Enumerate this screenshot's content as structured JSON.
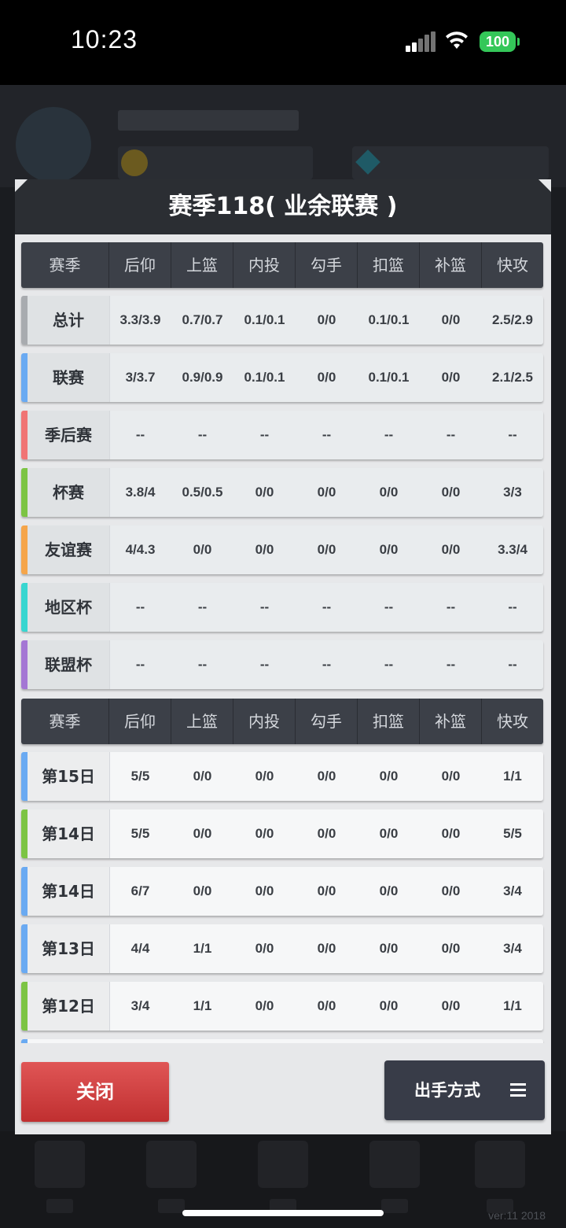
{
  "status_bar": {
    "time": "10:23",
    "battery": "100"
  },
  "version": "ver:11  2018",
  "dialog": {
    "title": "赛季118( 业余联赛 )",
    "close_label": "关闭",
    "shot_type_label": "出手方式"
  },
  "columns": [
    "赛季",
    "后仰",
    "上篮",
    "内投",
    "勾手",
    "扣篮",
    "补篮",
    "快攻"
  ],
  "season_rows": [
    {
      "label": "总计",
      "color": "#a8abaf",
      "values": [
        "3.3/3.9",
        "0.7/0.7",
        "0.1/0.1",
        "0/0",
        "0.1/0.1",
        "0/0",
        "2.5/2.9"
      ]
    },
    {
      "label": "联赛",
      "color": "#6aaaf2",
      "values": [
        "3/3.7",
        "0.9/0.9",
        "0.1/0.1",
        "0/0",
        "0.1/0.1",
        "0/0",
        "2.1/2.5"
      ]
    },
    {
      "label": "季后赛",
      "color": "#f07474",
      "values": [
        "--",
        "--",
        "--",
        "--",
        "--",
        "--",
        "--"
      ]
    },
    {
      "label": "杯赛",
      "color": "#7cc444",
      "values": [
        "3.8/4",
        "0.5/0.5",
        "0/0",
        "0/0",
        "0/0",
        "0/0",
        "3/3"
      ]
    },
    {
      "label": "友谊赛",
      "color": "#f5a54a",
      "values": [
        "4/4.3",
        "0/0",
        "0/0",
        "0/0",
        "0/0",
        "0/0",
        "3.3/4"
      ]
    },
    {
      "label": "地区杯",
      "color": "#38d6d0",
      "values": [
        "--",
        "--",
        "--",
        "--",
        "--",
        "--",
        "--"
      ]
    },
    {
      "label": "联盟杯",
      "color": "#a477d4",
      "values": [
        "--",
        "--",
        "--",
        "--",
        "--",
        "--",
        "--"
      ]
    }
  ],
  "game_rows": [
    {
      "label": "第15日",
      "color": "#6aaaf2",
      "values": [
        "5/5",
        "0/0",
        "0/0",
        "0/0",
        "0/0",
        "0/0",
        "1/1"
      ]
    },
    {
      "label": "第14日",
      "color": "#7cc444",
      "values": [
        "5/5",
        "0/0",
        "0/0",
        "0/0",
        "0/0",
        "0/0",
        "5/5"
      ]
    },
    {
      "label": "第14日",
      "color": "#6aaaf2",
      "values": [
        "6/7",
        "0/0",
        "0/0",
        "0/0",
        "0/0",
        "0/0",
        "3/4"
      ]
    },
    {
      "label": "第13日",
      "color": "#6aaaf2",
      "values": [
        "4/4",
        "1/1",
        "0/0",
        "0/0",
        "0/0",
        "0/0",
        "3/4"
      ]
    },
    {
      "label": "第12日",
      "color": "#7cc444",
      "values": [
        "3/4",
        "1/1",
        "0/0",
        "0/0",
        "0/0",
        "0/0",
        "1/1"
      ]
    }
  ]
}
